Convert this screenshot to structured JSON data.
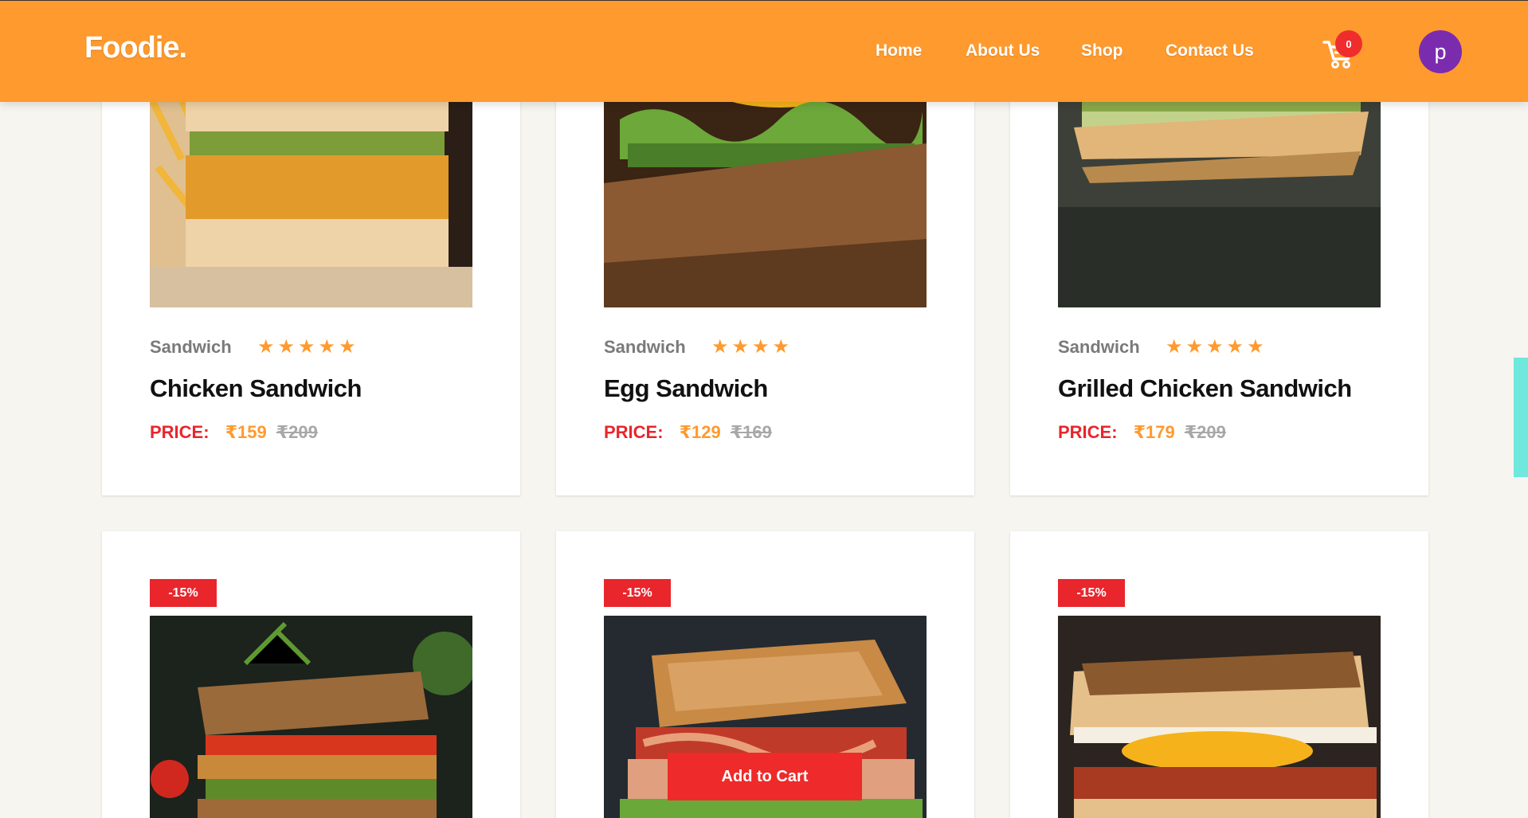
{
  "header": {
    "logo": "Foodie.",
    "nav": [
      "Home",
      "About Us",
      "Shop",
      "Contact Us"
    ],
    "cart_count": "0",
    "avatar_letter": "p",
    "background": "#ff9a2e"
  },
  "products_top": [
    {
      "category": "Sandwich",
      "stars": "★★★★★",
      "rating": 5,
      "title": "Chicken Sandwich",
      "price_label": "PRICE:",
      "price": "₹159",
      "old_price": "₹209"
    },
    {
      "category": "Sandwich",
      "stars": "★★★★",
      "rating": 4,
      "title": "Egg Sandwich",
      "price_label": "PRICE:",
      "price": "₹129",
      "old_price": "₹169"
    },
    {
      "category": "Sandwich",
      "stars": "★★★★★",
      "rating": 5,
      "title": "Grilled Chicken Sandwich",
      "price_label": "PRICE:",
      "price": "₹179",
      "old_price": "₹209"
    }
  ],
  "products_bottom": [
    {
      "discount": "-15%"
    },
    {
      "discount": "-15%"
    },
    {
      "discount": "-15%"
    }
  ],
  "add_to_cart": "Add to Cart",
  "colors": {
    "accent": "#ff9a2e",
    "price_red": "#e8262c",
    "avatar": "#7b2cae",
    "side_tab": "#6fe8de"
  }
}
